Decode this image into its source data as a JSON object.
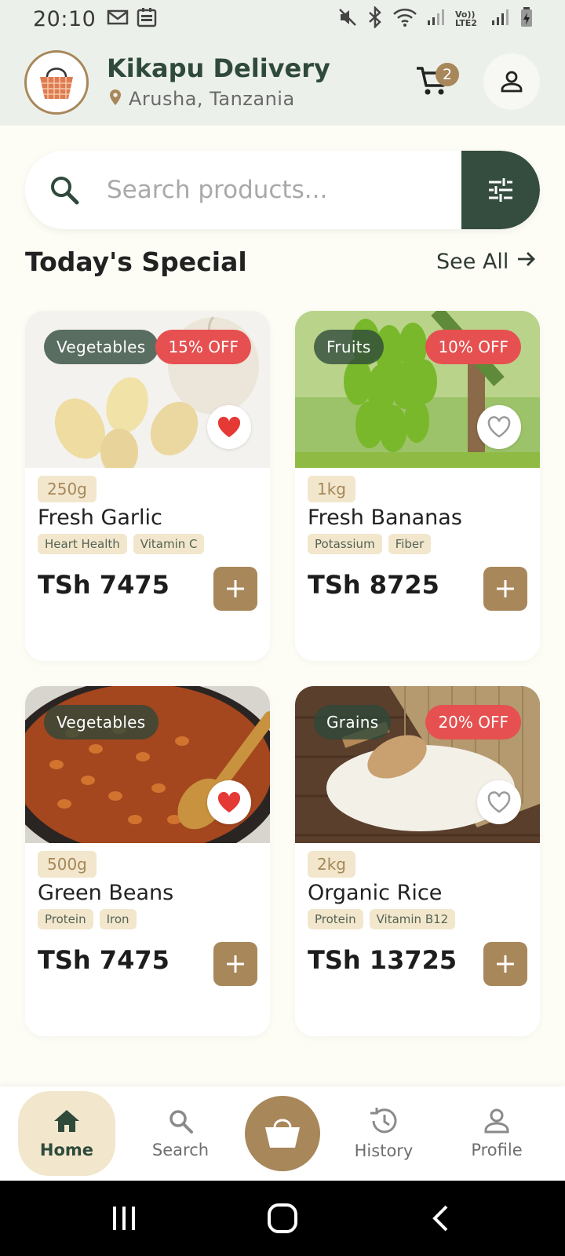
{
  "status_bar": {
    "time": "20:10",
    "left_icons": [
      "gmail-icon",
      "calendar-icon"
    ],
    "right_icons": [
      "mute-icon",
      "bluetooth-icon",
      "wifi-icon",
      "signal-icon",
      "volte-icon",
      "signal-icon-2",
      "battery-icon"
    ],
    "volte_label": "Vo)) LTE2"
  },
  "header": {
    "title": "Kikapu Delivery",
    "location": "Arusha, Tanzania",
    "cart_count": "2",
    "colors": {
      "brand": "#2f4a3b",
      "accent": "#a8875a",
      "header_bg": "#ecf0ea"
    }
  },
  "search": {
    "placeholder": "Search products..."
  },
  "section": {
    "title": "Today's Special",
    "see_all": "See All"
  },
  "products": [
    {
      "category": "Vegetables",
      "discount": "15% OFF",
      "favorite": true,
      "weight": "250g",
      "name": "Fresh Garlic",
      "tags": [
        "Heart Health",
        "Vitamin C"
      ],
      "price": "TSh 7475",
      "image": "garlic"
    },
    {
      "category": "Fruits",
      "discount": "10% OFF",
      "favorite": false,
      "weight": "1kg",
      "name": "Fresh Bananas",
      "tags": [
        "Potassium",
        "Fiber"
      ],
      "price": "TSh 8725",
      "image": "bananas"
    },
    {
      "category": "Vegetables",
      "discount": "",
      "favorite": true,
      "weight": "500g",
      "name": "Green Beans",
      "tags": [
        "Protein",
        "Iron"
      ],
      "price": "TSh 7475",
      "image": "beans"
    },
    {
      "category": "Grains",
      "discount": "20% OFF",
      "favorite": false,
      "weight": "2kg",
      "name": "Organic Rice",
      "tags": [
        "Protein",
        "Vitamin B12"
      ],
      "price": "TSh 13725",
      "image": "rice"
    }
  ],
  "bottom_nav": {
    "items": [
      {
        "label": "Home",
        "icon": "home-icon",
        "active": true
      },
      {
        "label": "Search",
        "icon": "search-icon",
        "active": false
      },
      {
        "label": "History",
        "icon": "history-icon",
        "active": false
      },
      {
        "label": "Profile",
        "icon": "profile-icon",
        "active": false
      }
    ],
    "center_icon": "basket-icon"
  },
  "system_nav": [
    "recents-icon",
    "home-circle-icon",
    "back-icon"
  ]
}
